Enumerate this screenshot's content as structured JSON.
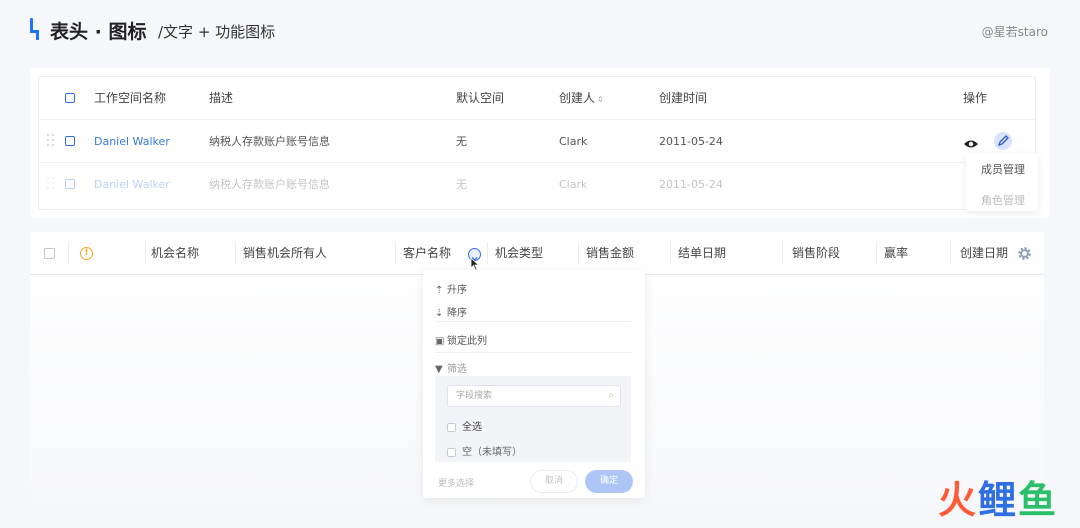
{
  "header": {
    "title": "表头 · 图标",
    "subtitle": "/文字 + 功能图标",
    "credit": "@星若staro"
  },
  "table1": {
    "columns": [
      "工作空间名称",
      "描述",
      "默认空间",
      "创建人",
      "创建时间",
      "操作"
    ],
    "rows": [
      {
        "name": "Daniel Walker",
        "desc": "纳税人存款账户账号信息",
        "default": "无",
        "creator": "Clark",
        "date": "2011-05-24"
      },
      {
        "name": "Daniel Walker",
        "desc": "纳税人存款账户账号信息",
        "default": "无",
        "creator": "Clark",
        "date": "2011-05-24"
      }
    ],
    "menu": [
      "成员管理",
      "角色管理"
    ]
  },
  "table2": {
    "columns": [
      "机会名称",
      "销售机会所有人",
      "客户名称",
      "机会类型",
      "销售金额",
      "结单日期",
      "销售阶段",
      "赢率",
      "创建日期"
    ]
  },
  "filter": {
    "asc": "升序",
    "desc": "降序",
    "lock": "锁定此列",
    "filter": "筛选",
    "search_placeholder": "字段搜索",
    "select_all": "全选",
    "empty": "空（未填写）",
    "more": "更多选择",
    "cancel": "取消",
    "ok": "确定"
  },
  "watermark": "火鲤鱼",
  "colors": {
    "accent": "#1e73ff",
    "link": "#3a78e0",
    "warning": "#f5a623"
  }
}
